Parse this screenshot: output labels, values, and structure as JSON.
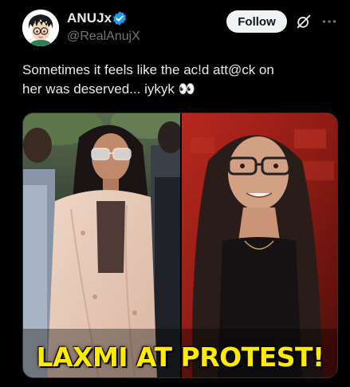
{
  "author": {
    "display_name": "ANUJx",
    "handle": "@RealAnujX",
    "verified": true,
    "avatar_icon": "anime-boy-avatar"
  },
  "actions": {
    "follow_label": "Follow",
    "grok_icon": "grok-icon",
    "more_icon": "more-icon"
  },
  "post": {
    "text_line1": "Sometimes it feels like the ac!d att@ck on",
    "text_line2": "her was deserved... iykyk",
    "emoji": "👀"
  },
  "media": {
    "caption": "LAXMI AT PROTEST!",
    "caption_color": "#ffeb00",
    "left_panel": "woman-in-sunglasses-at-protest-photo",
    "right_panel": "woman-with-glasses-red-background-photo"
  },
  "colors": {
    "background": "#000000",
    "text_primary": "#e7e9ea",
    "text_secondary": "#71767b",
    "verified_blue": "#1d9bf0"
  }
}
